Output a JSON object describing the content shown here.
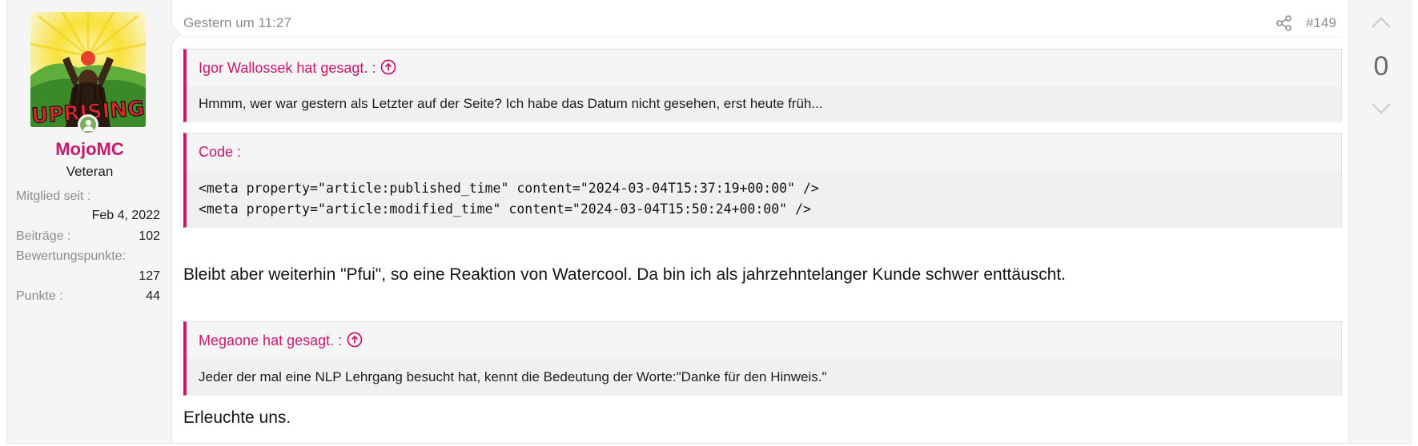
{
  "user": {
    "name": "MojoMC",
    "title": "Veteran",
    "stats": [
      {
        "label": "Mitglied seit :",
        "value": "Feb 4, 2022"
      },
      {
        "label": "Beiträge :",
        "value": "102"
      },
      {
        "label": "Bewertungspunkte:",
        "value": "127"
      },
      {
        "label": "Punkte :",
        "value": "44"
      }
    ],
    "avatar_text": "UPRISING",
    "online_color": "#7ab15a"
  },
  "post": {
    "date": "Gestern um 11:27",
    "number": "#149",
    "share_icon": "share-icon",
    "quotes": [
      {
        "title": "Igor Wallossek hat gesagt. :",
        "text": "Hmmm, wer war gestern als Letzter auf der Seite? Ich habe das Datum nicht gesehen, erst heute früh..."
      },
      {
        "title": "Megaone hat gesagt. :",
        "text": "Jeder der mal eine NLP Lehrgang besucht hat, kennt die Bedeutung der Worte:\"Danke für den Hinweis.\""
      }
    ],
    "code": {
      "title": "Code :",
      "lines": [
        "<meta property=\"article:published_time\" content=\"2024-03-04T15:37:19+00:00\" />",
        "<meta property=\"article:modified_time\" content=\"2024-03-04T15:50:24+00:00\" />"
      ]
    },
    "body": [
      "Bleibt aber weiterhin \"Pfui\", so eine Reaktion von Watercool. Da bin ich als jahrzehntelanger Kunde schwer enttäuscht.",
      "Erleuchte uns."
    ]
  },
  "vote": {
    "count": "0"
  },
  "colors": {
    "accent": "#c7186c",
    "quote_bg": "#f5f5f5",
    "sidebar_bg": "#f5f5f5"
  }
}
